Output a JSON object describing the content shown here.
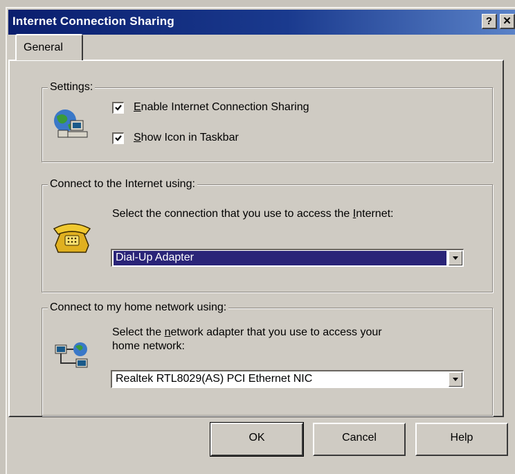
{
  "window": {
    "title": "Internet Connection Sharing",
    "help_button": "?",
    "close_button": "✕"
  },
  "tabs": [
    {
      "label": "General",
      "selected": true
    }
  ],
  "settings": {
    "legend": "Settings:",
    "enable_sharing": {
      "label_access_key": "E",
      "label_rest": "nable Internet Connection Sharing",
      "checked": true
    },
    "show_icon": {
      "label_access_key": "S",
      "label_rest": "how Icon in Taskbar",
      "checked": true
    }
  },
  "internet": {
    "legend": "Connect to the Internet using:",
    "prompt_pre": "Select the connection that you use to access the ",
    "prompt_key": "I",
    "prompt_post": "nternet:",
    "selected": "Dial-Up Adapter"
  },
  "home": {
    "legend": "Connect to my home network using:",
    "prompt_line1_pre": "Select the ",
    "prompt_line1_key": "n",
    "prompt_line1_post": "etwork adapter that you use to access your",
    "prompt_line2": "home network:",
    "selected": "Realtek RTL8029(AS) PCI Ethernet NIC"
  },
  "buttons": {
    "ok": "OK",
    "cancel": "Cancel",
    "help": "Help"
  },
  "colors": {
    "title_bar": "#0a1e6e",
    "selection": "#2a2478",
    "face": "#cfcbc3"
  }
}
